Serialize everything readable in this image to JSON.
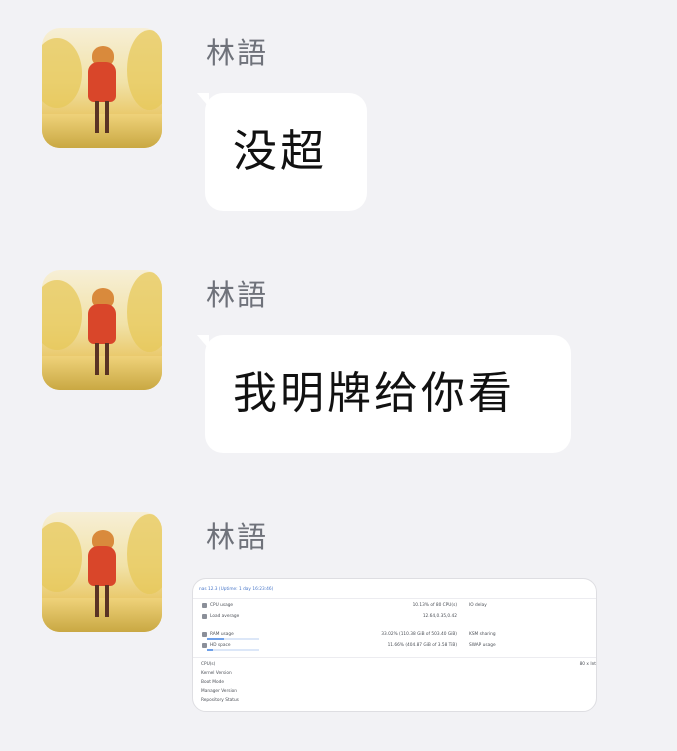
{
  "messages": [
    {
      "sender": "林語",
      "text": "没超"
    },
    {
      "sender": "林語",
      "text": "我明牌给你看"
    },
    {
      "sender": "林語",
      "image": "proxmox-summary-screenshot"
    }
  ],
  "embedded_screenshot": {
    "header": "nas 12.3 (Uptime: 1 day 16:23:46)",
    "rows": [
      {
        "label": "CPU usage",
        "value": "10.13% of 80 CPU(s)",
        "right_label": "IO delay",
        "icon": "cpu-icon"
      },
      {
        "label": "Load average",
        "value": "12.64,0.35,0.42",
        "icon": "load-icon"
      },
      {
        "label": "RAM usage",
        "value": "33.02% (110.38 GiB of 503.40 GiB)",
        "right_label": "KSM sharing",
        "icon": "ram-icon",
        "usage": 0.3302
      },
      {
        "label": "HD space",
        "value": "11.66% (404.87 GiB of 3.58 TiB)",
        "right_label": "SWAP usage",
        "icon": "disk-icon",
        "usage": 0.1166
      }
    ],
    "right_edge_value": "80 x Int",
    "info_labels": [
      "CPU(s)",
      "Kernel Version",
      "Boot Mode",
      "Manager Version",
      "Repository Status"
    ]
  }
}
